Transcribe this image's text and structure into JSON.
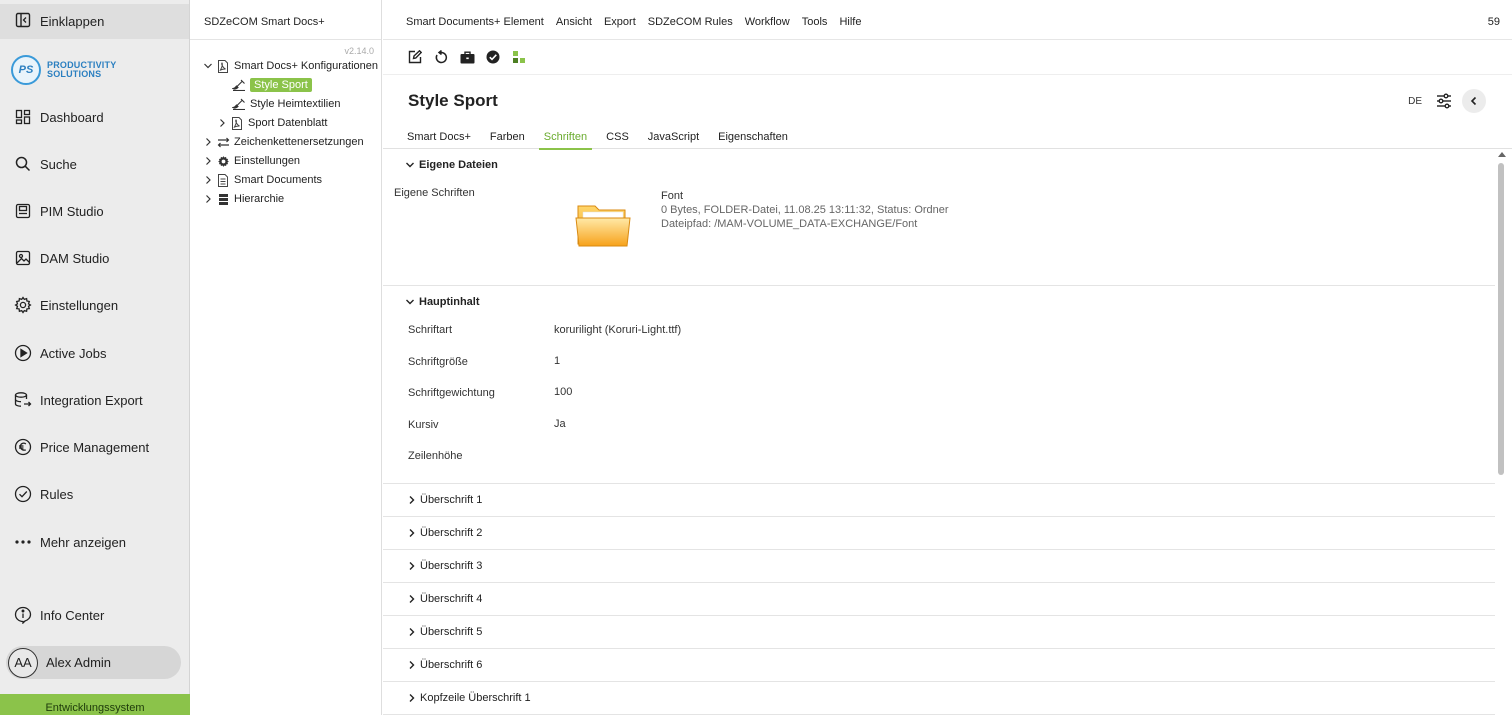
{
  "nav": {
    "collapse_label": "Einklappen",
    "logo_mark": "PS",
    "logo_line1": "PRODUCTIVITY",
    "logo_line2": "SOLUTIONS",
    "items": [
      {
        "label": "Dashboard",
        "icon": "dashboard-icon"
      },
      {
        "label": "Suche",
        "icon": "search-icon"
      },
      {
        "label": "PIM Studio",
        "icon": "pim-icon"
      },
      {
        "label": "DAM Studio",
        "icon": "image-icon"
      },
      {
        "label": "Einstellungen",
        "icon": "gear-icon"
      },
      {
        "label": "Active Jobs",
        "icon": "play-icon"
      },
      {
        "label": "Integration Export",
        "icon": "database-export-icon"
      },
      {
        "label": "Price Management",
        "icon": "euro-icon"
      },
      {
        "label": "Rules",
        "icon": "check-circle-icon"
      },
      {
        "label": "Mehr anzeigen",
        "icon": "more-icon"
      }
    ],
    "info_center": "Info Center",
    "user": {
      "initials": "AA",
      "name": "Alex Admin"
    },
    "environment": "Entwicklungssystem"
  },
  "tree": {
    "title": "SDZeCOM Smart Docs+",
    "version": "v2.14.0",
    "root": "Smart Docs+ Konfigurationen",
    "style_sport": "Style Sport",
    "style_heimtextilien": "Style Heimtextilien",
    "sport_datenblatt": "Sport Datenblatt",
    "zeichenketten": "Zeichenkettenersetzungen",
    "einstellungen": "Einstellungen",
    "smart_documents": "Smart Documents",
    "hierarchie": "Hierarchie"
  },
  "menubar": {
    "items": [
      "Smart Documents+ Element",
      "Ansicht",
      "Export",
      "SDZeCOM Rules",
      "Workflow",
      "Tools",
      "Hilfe"
    ],
    "count": "59"
  },
  "page": {
    "title": "Style Sport",
    "language": "DE"
  },
  "tabs": [
    "Smart Docs+",
    "Farben",
    "Schriften",
    "CSS",
    "JavaScript",
    "Eigenschaften"
  ],
  "active_tab": "Schriften",
  "eigene_dateien": {
    "header": "Eigene Dateien",
    "label": "Eigene Schriften",
    "file_name": "Font",
    "file_info": "0 Bytes, FOLDER-Datei, 11.08.25 13:11:32, Status: Ordner",
    "file_path": "Dateipfad: /MAM-VOLUME_DATA-EXCHANGE/Font"
  },
  "hauptinhalt": {
    "header": "Hauptinhalt",
    "fields": {
      "schriftart_label": "Schriftart",
      "schriftart_value": "korurilight (Koruri-Light.ttf)",
      "groesse_label": "Schriftgröße",
      "groesse_value": "1",
      "gewichtung_label": "Schriftgewichtung",
      "gewichtung_value": "100",
      "kursiv_label": "Kursiv",
      "kursiv_value": "Ja",
      "zeilenhoehe_label": "Zeilenhöhe"
    }
  },
  "collapsed_sections": [
    "Überschrift 1",
    "Überschrift 2",
    "Überschrift 3",
    "Überschrift 4",
    "Überschrift 5",
    "Überschrift 6",
    "Kopfzeile Überschrift 1"
  ],
  "colors": {
    "accent": "#8bc34a",
    "sidebar_bg": "#ececec",
    "logo_blue": "#2b7fc0"
  }
}
